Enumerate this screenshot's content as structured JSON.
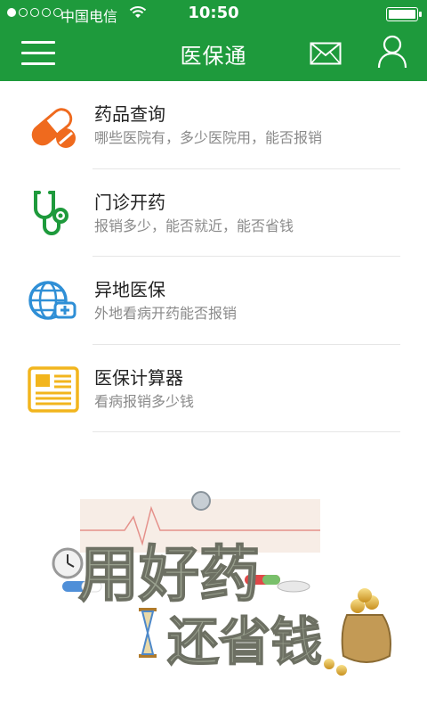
{
  "status_bar": {
    "carrier": "中国电信",
    "time": "10:50"
  },
  "header": {
    "title": "医保通",
    "menu_icon": "hamburger-menu-icon",
    "mail_icon": "envelope-icon",
    "user_icon": "user-profile-icon"
  },
  "menu": {
    "items": [
      {
        "title": "药品查询",
        "subtitle": "哪些医院有，多少医院用，能否报销",
        "icon": "pill-capsule-icon",
        "color": "#ef6a1e"
      },
      {
        "title": "门诊开药",
        "subtitle": "报销多少，能否就近，能否省钱",
        "icon": "stethoscope-icon",
        "color": "#1e9a3c"
      },
      {
        "title": "异地医保",
        "subtitle": "外地看病开药能否报销",
        "icon": "globe-medical-icon",
        "color": "#2f8fd6"
      },
      {
        "title": "医保计算器",
        "subtitle": "看病报销多少钱",
        "icon": "newspaper-document-icon",
        "color": "#f2b51d"
      }
    ]
  },
  "banner": {
    "line1": "用好药",
    "line2": "还省钱"
  },
  "colors": {
    "brand": "#1e9a3c",
    "title_text": "#222222",
    "subtitle_text": "#8a8a8a"
  }
}
